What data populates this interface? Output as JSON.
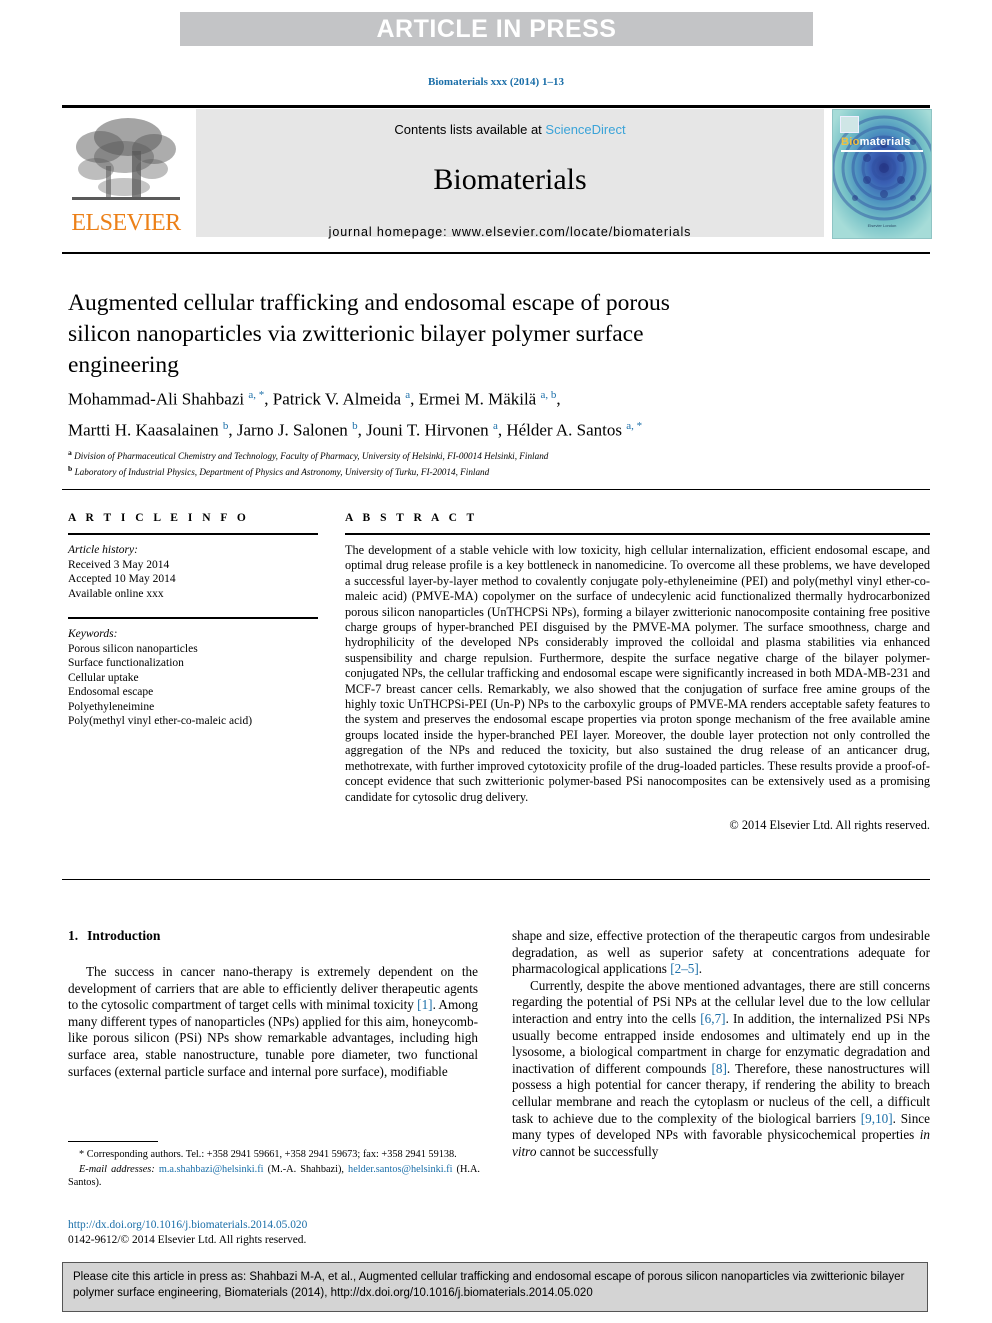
{
  "banner": {
    "text": "ARTICLE IN PRESS"
  },
  "running_head": "Biomaterials xxx (2014) 1–13",
  "masthead": {
    "contents_prefix": "Contents lists available at ",
    "sciencedirect": "ScienceDirect",
    "journal_title": "Biomaterials",
    "homepage": "journal homepage: www.elsevier.com/locate/biomaterials",
    "publisher_logo_text": "ELSEVIER",
    "cover_title_bio": "Bio",
    "cover_title_materials": "materials",
    "cover_footer": "Elsevier\nLondon"
  },
  "article": {
    "title": "Augmented cellular trafficking and endosomal escape of porous silicon nanoparticles via zwitterionic bilayer polymer surface engineering",
    "authors_line1_part1": "Mohammad-Ali Shahbazi ",
    "authors_line1_sup1": "a, *",
    "authors_line1_part2": ", Patrick V. Almeida ",
    "authors_line1_sup2": "a",
    "authors_line1_part3": ", Ermei M. Mäkilä ",
    "authors_line1_sup3": "a, b",
    "authors_line1_part4": ",",
    "authors_line2_part1": "Martti H. Kaasalainen ",
    "authors_line2_sup1": "b",
    "authors_line2_part2": ", Jarno J. Salonen ",
    "authors_line2_sup2": "b",
    "authors_line2_part3": ", Jouni T. Hirvonen ",
    "authors_line2_sup3": "a",
    "authors_line2_part4": ", Hélder A. Santos ",
    "authors_line2_sup4": "a, *",
    "affiliation_a_sup": "a",
    "affiliation_a": " Division of Pharmaceutical Chemistry and Technology, Faculty of Pharmacy, University of Helsinki, FI-00014 Helsinki, Finland",
    "affiliation_b_sup": "b",
    "affiliation_b": " Laboratory of Industrial Physics, Department of Physics and Astronomy, University of Turku, FI-20014, Finland"
  },
  "article_info": {
    "heading": "A R T I C L E  I N F O",
    "history_label": "Article history:",
    "history": [
      "Received 3 May 2014",
      "Accepted 10 May 2014",
      "Available online xxx"
    ],
    "keywords_label": "Keywords:",
    "keywords": [
      "Porous silicon nanoparticles",
      "Surface functionalization",
      "Cellular uptake",
      "Endosomal escape",
      "Polyethyleneimine",
      "Poly(methyl vinyl ether-co-maleic acid)"
    ]
  },
  "abstract": {
    "heading": "A B S T R A C T",
    "text": "The development of a stable vehicle with low toxicity, high cellular internalization, efficient endosomal escape, and optimal drug release profile is a key bottleneck in nanomedicine. To overcome all these problems, we have developed a successful layer-by-layer method to covalently conjugate poly-ethyleneimine (PEI) and poly(methyl vinyl ether-co-maleic acid) (PMVE-MA) copolymer on the surface of undecylenic acid functionalized thermally hydrocarbonized porous silicon nanoparticles (UnTHCPSi NPs), forming a bilayer zwitterionic nanocomposite containing free positive charge groups of hyper-branched PEI disguised by the PMVE-MA polymer. The surface smoothness, charge and hydrophilicity of the developed NPs considerably improved the colloidal and plasma stabilities via enhanced suspensibility and charge repulsion. Furthermore, despite the surface negative charge of the bilayer polymer-conjugated NPs, the cellular trafficking and endosomal escape were significantly increased in both MDA-MB-231 and MCF-7 breast cancer cells. Remarkably, we also showed that the conjugation of surface free amine groups of the highly toxic UnTHCPSi-PEI (Un-P) NPs to the carboxylic groups of PMVE-MA renders acceptable safety features to the system and preserves the endosomal escape properties via proton sponge mechanism of the free available amine groups located inside the hyper-branched PEI layer. Moreover, the double layer protection not only controlled the aggregation of the NPs and reduced the toxicity, but also sustained the drug release of an anticancer drug, methotrexate, with further improved cytotoxicity profile of the drug-loaded particles. These results provide a proof-of-concept evidence that such zwitterionic polymer-based PSi nanocomposites can be extensively used as a promising candidate for cytosolic drug delivery.",
    "copyright": "© 2014 Elsevier Ltd. All rights reserved."
  },
  "introduction": {
    "number": "1.",
    "heading": "Introduction",
    "left_p1_a": "The success in cancer nano-therapy is extremely dependent on the development of carriers that are able to efficiently deliver therapeutic agents to the cytosolic compartment of target cells with minimal toxicity ",
    "left_p1_ref1": "[1]",
    "left_p1_b": ". Among many different types of nanoparticles (NPs) applied for this aim, honeycomb-like porous silicon (PSi) NPs show remarkable advantages, including high surface area, stable nanostructure, tunable pore diameter, two functional surfaces (external particle surface and internal pore surface), modifiable",
    "right_p1_a": "shape and size, effective protection of the therapeutic cargos from undesirable degradation, as well as superior safety at concentrations adequate for pharmacological applications ",
    "right_p1_ref": "[2–5]",
    "right_p1_b": ".",
    "right_p2_a": "Currently, despite the above mentioned advantages, there are still concerns regarding the potential of PSi NPs at the cellular level due to the low cellular interaction and entry into the cells ",
    "right_p2_ref1": "[6,7]",
    "right_p2_b": ". In addition, the internalized PSi NPs usually become entrapped inside endosomes and ultimately end up in the lysosome, a biological compartment in charge for enzymatic degradation and inactivation of different compounds ",
    "right_p2_ref2": "[8]",
    "right_p2_c": ". Therefore, these nanostructures will possess a high potential for cancer therapy, if rendering the ability to breach cellular membrane and reach the cytoplasm or nucleus of the cell, a difficult task to achieve due to the complexity of the biological barriers ",
    "right_p2_ref3": "[9,10]",
    "right_p2_d": ". Since many types of developed NPs with favorable physicochemical properties ",
    "right_p2_italic": "in vitro",
    "right_p2_e": " cannot be successfully"
  },
  "footnotes": {
    "corresponding": "* Corresponding authors. Tel.: +358 2941 59661, +358 2941 59673; fax: +358 2941 59138.",
    "email_label": "E-mail addresses:",
    "email1": "m.a.shahbazi@helsinki.fi",
    "email1_owner": " (M.-A. Shahbazi), ",
    "email2": "helder.santos@helsinki.fi",
    "email2_owner": " (H.A. Santos)."
  },
  "doi_block": {
    "doi_url": "http://dx.doi.org/10.1016/j.biomaterials.2014.05.020",
    "issn_line": "0142-9612/© 2014 Elsevier Ltd. All rights reserved."
  },
  "cite_box": {
    "text": "Please cite this article in press as: Shahbazi M-A, et al., Augmented cellular trafficking and endosomal escape of porous silicon nanoparticles via zwitterionic bilayer polymer surface engineering, Biomaterials (2014), http://dx.doi.org/10.1016/j.biomaterials.2014.05.020"
  },
  "colors": {
    "link": "#1a6ea8",
    "sciencedirect": "#3aa3d8",
    "elsevier_orange": "#ec8018",
    "banner_grey": "#c3c4c6",
    "cite_box_grey": "#d4d4d4"
  }
}
